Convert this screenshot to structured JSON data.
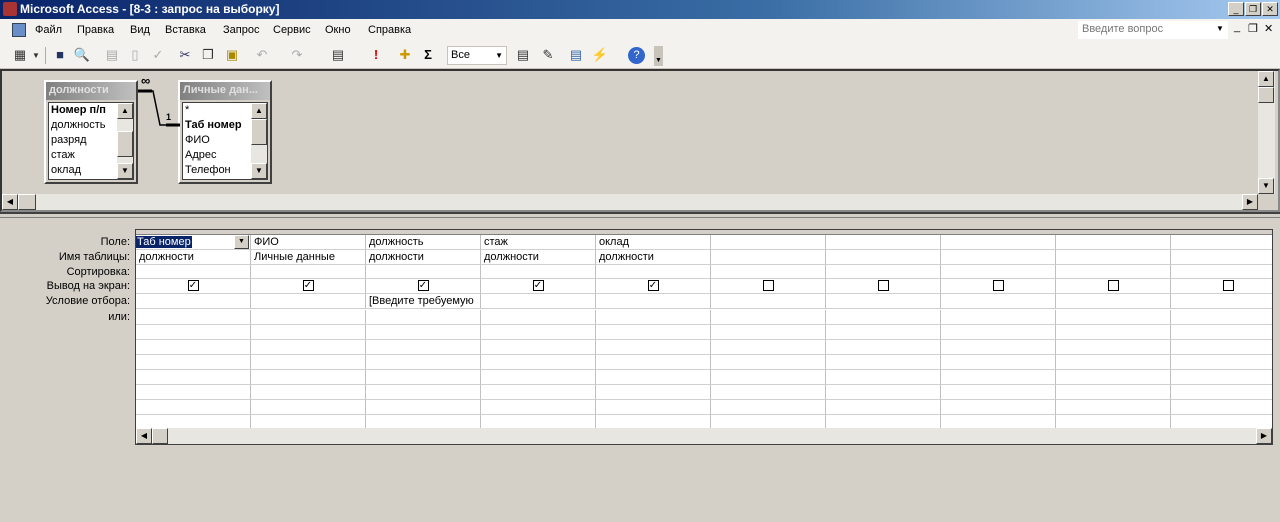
{
  "window": {
    "title": "Microsoft Access - [8-3 : запрос на выборку]"
  },
  "menu": [
    "Файл",
    "Правка",
    "Вид",
    "Вставка",
    "Запрос",
    "Сервис",
    "Окно",
    "Справка"
  ],
  "ask": {
    "placeholder": "Введите вопрос"
  },
  "toolbar": {
    "query_type": "Все",
    "sum": "Σ",
    "run": "!"
  },
  "tables": [
    {
      "title": "должности",
      "fields": [
        "Номер п/п",
        "должность",
        "разряд",
        "стаж",
        "оклад"
      ],
      "key": "Номер п/п"
    },
    {
      "title": "Личные дан...",
      "fields": [
        "*",
        "Таб номер",
        "ФИО",
        "Адрес",
        "Телефон"
      ],
      "key": "Таб номер"
    }
  ],
  "relation": {
    "many": "∞",
    "one": "1"
  },
  "grid": {
    "row_labels": [
      "Поле:",
      "Имя таблицы:",
      "Сортировка:",
      "Вывод на экран:",
      "Условие отбора:",
      "или:"
    ],
    "columns": [
      {
        "field": "Таб номер",
        "table": "должности",
        "show": true,
        "criteria": ""
      },
      {
        "field": "ФИО",
        "table": "Личные данные",
        "show": true,
        "criteria": ""
      },
      {
        "field": "должность",
        "table": "должности",
        "show": true,
        "criteria": "[Введите требуемую"
      },
      {
        "field": "стаж",
        "table": "должности",
        "show": true,
        "criteria": ""
      },
      {
        "field": "оклад",
        "table": "должности",
        "show": true,
        "criteria": ""
      },
      {
        "field": "",
        "table": "",
        "show": false,
        "criteria": ""
      },
      {
        "field": "",
        "table": "",
        "show": false,
        "criteria": ""
      },
      {
        "field": "",
        "table": "",
        "show": false,
        "criteria": ""
      },
      {
        "field": "",
        "table": "",
        "show": false,
        "criteria": ""
      },
      {
        "field": "",
        "table": "",
        "show": false,
        "criteria": ""
      }
    ]
  }
}
